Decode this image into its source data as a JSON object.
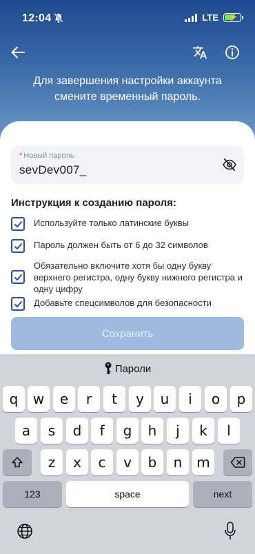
{
  "status_bar": {
    "time": "12:04",
    "network": "LTE",
    "battery_level": 0.6
  },
  "header": {
    "back_icon": "arrow-left-icon",
    "translate_icon": "translate-icon",
    "info_icon": "info-icon",
    "message": "Для завершения настройки аккаунта смените временный пароль."
  },
  "password_field": {
    "required_mark": "*",
    "label": "Новый пароль",
    "value": "sevDev007_",
    "toggle_icon": "eye-off-icon"
  },
  "instructions": {
    "title": "Инструкция к созданию пароля:",
    "rules": [
      {
        "text": "Используйте только латинские буквы",
        "checked": true
      },
      {
        "text": "Пароль должен быть от 6 до 32 символов",
        "checked": true
      },
      {
        "text": "Обязательно включите хотя бы одну букву верхнего регистра, одну букву нижнего регистра и одну цифру",
        "checked": true
      },
      {
        "text": "Добавьте спецсимволов для безопасности",
        "checked": true
      }
    ]
  },
  "save_button": {
    "label": "Сохранить"
  },
  "keyboard": {
    "suggestion": "Пароли",
    "suggestion_icon": "key-icon",
    "row1": [
      "q",
      "w",
      "e",
      "r",
      "t",
      "y",
      "u",
      "i",
      "o",
      "p"
    ],
    "row2": [
      "a",
      "s",
      "d",
      "f",
      "g",
      "h",
      "j",
      "k",
      "l"
    ],
    "row3": [
      "z",
      "x",
      "c",
      "v",
      "b",
      "n",
      "m"
    ],
    "numbers_key": "123",
    "space_key": "space",
    "next_key": "next",
    "shift_icon": "shift-icon",
    "delete_icon": "backspace-icon",
    "globe_icon": "globe-icon",
    "mic_icon": "microphone-icon"
  }
}
